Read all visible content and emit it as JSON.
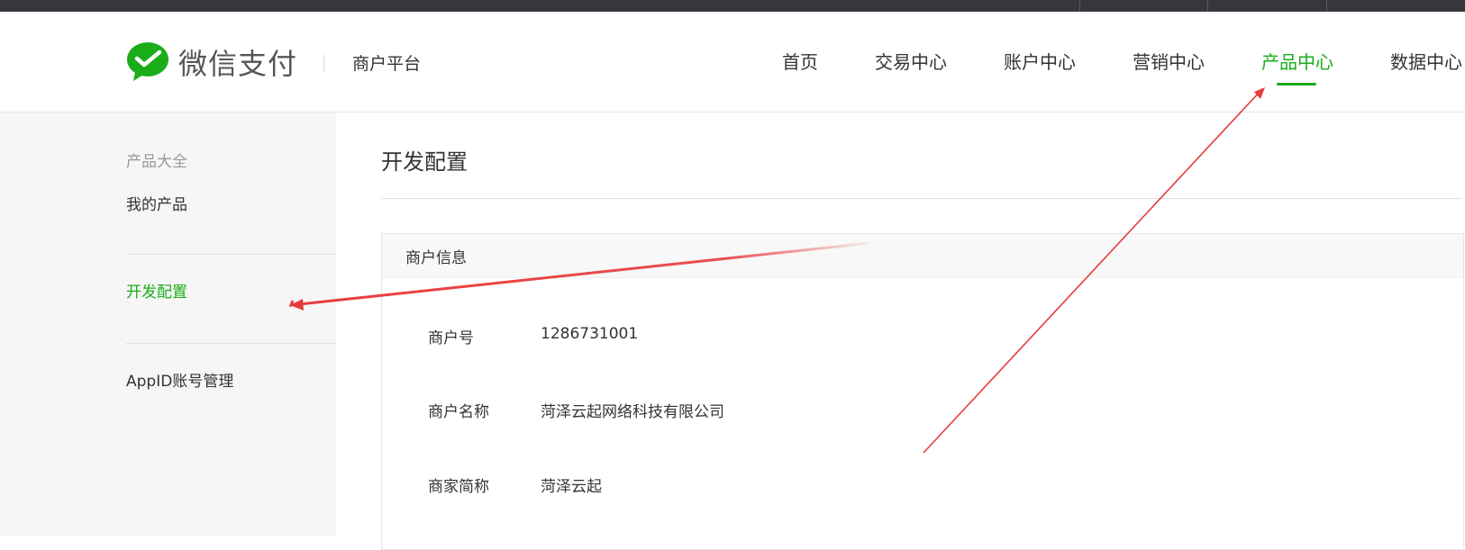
{
  "brand": {
    "name": "微信支付",
    "subtitle": "商户平台",
    "color": "#1aad19"
  },
  "nav": {
    "items": [
      {
        "label": "首页"
      },
      {
        "label": "交易中心"
      },
      {
        "label": "账户中心"
      },
      {
        "label": "营销中心"
      },
      {
        "label": "产品中心",
        "active": true
      },
      {
        "label": "数据中心"
      }
    ]
  },
  "sidebar": {
    "items": [
      {
        "label": "产品大全"
      },
      {
        "label": "我的产品"
      },
      {
        "label": "开发配置",
        "active": true
      },
      {
        "label": "AppID账号管理"
      }
    ]
  },
  "main": {
    "title": "开发配置",
    "section_title": "商户信息",
    "rows": [
      {
        "label": "商户号",
        "value": "1286731001"
      },
      {
        "label": "商户名称",
        "value": "菏泽云起网络科技有限公司"
      },
      {
        "label": "商家简称",
        "value": "菏泽云起"
      }
    ]
  },
  "annotations": {
    "arrow_color": "#e83b3b"
  }
}
